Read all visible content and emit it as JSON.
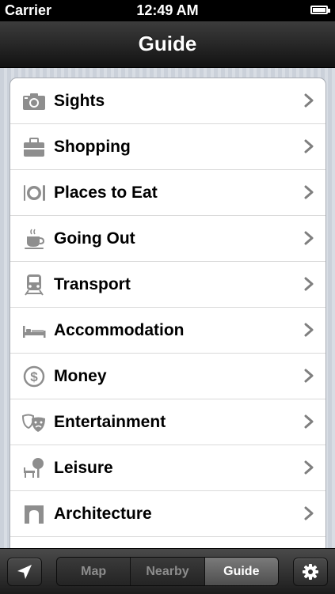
{
  "status_bar": {
    "carrier": "Carrier",
    "time": "12:49 AM",
    "battery_icon": "battery-full-icon"
  },
  "nav_bar": {
    "title": "Guide"
  },
  "guide_list": {
    "items": [
      {
        "label": "Sights",
        "icon": "camera-icon"
      },
      {
        "label": "Shopping",
        "icon": "briefcase-icon"
      },
      {
        "label": "Places to Eat",
        "icon": "plate-cutlery-icon"
      },
      {
        "label": "Going Out",
        "icon": "coffee-cup-icon"
      },
      {
        "label": "Transport",
        "icon": "train-icon"
      },
      {
        "label": "Accommodation",
        "icon": "bed-icon"
      },
      {
        "label": "Money",
        "icon": "dollar-icon"
      },
      {
        "label": "Entertainment",
        "icon": "theater-masks-icon"
      },
      {
        "label": "Leisure",
        "icon": "park-bench-tree-icon"
      },
      {
        "label": "Architecture",
        "icon": "arch-icon"
      }
    ]
  },
  "toolbar": {
    "locate_icon": "location-arrow-icon",
    "settings_icon": "gear-icon",
    "segments": [
      {
        "label": "Map",
        "selected": false
      },
      {
        "label": "Nearby",
        "selected": false
      },
      {
        "label": "Guide",
        "selected": true
      }
    ]
  },
  "colors": {
    "icon_gray": "#8e8e8e",
    "chevron_gray": "#7f7f7f",
    "nav_bar_dark": "#1a1a1a",
    "selected_segment": "#5f5f5f"
  }
}
